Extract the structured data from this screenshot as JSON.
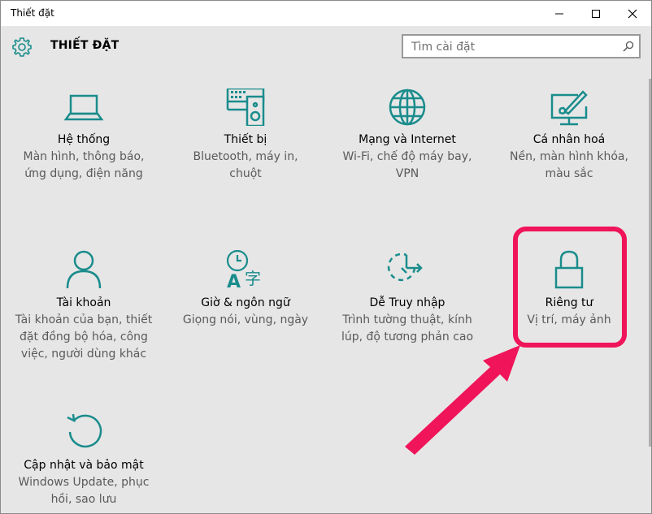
{
  "window": {
    "title": "Thiết đặt"
  },
  "header": {
    "title": "THIẾT ĐẶT"
  },
  "search": {
    "placeholder": "Tìm cài đặt"
  },
  "tiles": [
    {
      "label": "Hệ thống",
      "desc1": "Màn hình, thông báo,",
      "desc2": "ứng dụng, điện năng",
      "desc3": ""
    },
    {
      "label": "Thiết bị",
      "desc1": "Bluetooth, máy in,",
      "desc2": "chuột",
      "desc3": ""
    },
    {
      "label": "Mạng và Internet",
      "desc1": "Wi-Fi, chế độ máy bay,",
      "desc2": "VPN",
      "desc3": ""
    },
    {
      "label": "Cá nhân hoá",
      "desc1": "Nền, màn hình khóa,",
      "desc2": "màu sắc",
      "desc3": ""
    },
    {
      "label": "Tài khoản",
      "desc1": "Tài khoản của bạn, thiết",
      "desc2": "đặt đồng bộ hóa, công",
      "desc3": "việc, người dùng khác"
    },
    {
      "label": "Giờ & ngôn ngữ",
      "desc1": "Giọng nói, vùng, ngày",
      "desc2": "",
      "desc3": ""
    },
    {
      "label": "Dễ Truy nhập",
      "desc1": "Trình tường thuật, kính",
      "desc2": "lúp, độ tương phản cao",
      "desc3": ""
    },
    {
      "label": "Riêng tư",
      "desc1": "Vị trí, máy ảnh",
      "desc2": "",
      "desc3": ""
    },
    {
      "label": "Cập nhật và bảo mật",
      "desc1": "Windows Update, phục",
      "desc2": "hồi, sao lưu",
      "desc3": ""
    }
  ],
  "colors": {
    "accent": "#1a8c8c",
    "highlight": "#f0145a"
  }
}
